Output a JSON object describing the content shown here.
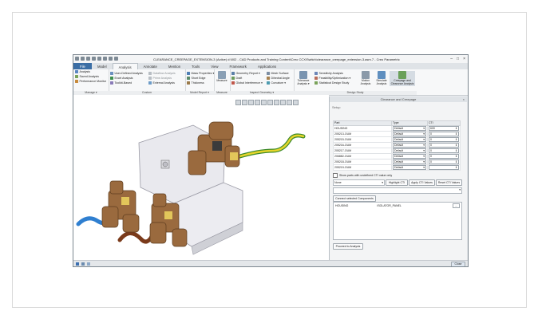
{
  "window": {
    "title": "CLEARANCE_CREEPAGE_EXTENSION-3 (Active) d:\\002 - CAD Products and Training Content\\Creo CCX\\Switch\\clearance_creepage_extension-3.asm.7 - Creo Parametric",
    "buttons": [
      "–",
      "□",
      "×"
    ]
  },
  "tabs": [
    "File",
    "Model",
    "Analysis",
    "Annotate",
    "Mention",
    "Tools",
    "View",
    "Framework",
    "Applications"
  ],
  "active_tab": "Analysis",
  "ribbon": {
    "manage": {
      "items": [
        "Analysis",
        "Saved Analysis",
        "Performance Monitor"
      ],
      "label": "Manage ▾"
    },
    "custom": {
      "col1": [
        "User-Defined Analysis",
        "Excel Analysis",
        "Toolkit-Based"
      ],
      "col2": [
        "Dataflow Analysis",
        "Prime Analysis",
        "External Analysis"
      ],
      "label": "Custom"
    },
    "model_report": {
      "items": [
        "Mass Properties ▾",
        "Short Edge",
        "Thickness"
      ],
      "label": "Model Report ▾"
    },
    "measure": {
      "button": "Measure",
      "label": "Measure"
    },
    "inspect": {
      "col1": [
        "Geometry Report ▾",
        "Draft",
        "Global Interference ▾"
      ],
      "col2": [
        "Mesh Surface",
        "Dihedral Angle",
        "Curvature ▾"
      ],
      "label": "Inspect Geometry ▾"
    },
    "design_study": {
      "tolerance": "Tolerance Analysis ▾",
      "col": [
        "Sensitivity Analysis",
        "Feasibility/Optimization ▾",
        "Statistical Design Study"
      ],
      "motion": "Motion Analysis",
      "simulate": "Simulate Analysis",
      "creepage": "Creepage and Clearance Analysis",
      "label": "Design Study"
    }
  },
  "panel": {
    "title": "Clearance and Creepage",
    "subtitle": "Setup",
    "columns": [
      "Part",
      "Type",
      "CTI"
    ],
    "rows": [
      {
        "part": "HOUSING",
        "type": "Default",
        "cti": "600"
      },
      {
        "part": "205213-OUM",
        "type": "Default",
        "cti": "0"
      },
      {
        "part": "205215-OUM",
        "type": "Default",
        "cti": "0"
      },
      {
        "part": "205216-OUM",
        "type": "Default",
        "cti": "0"
      },
      {
        "part": "205217-OUM",
        "type": "Default",
        "cti": "0"
      },
      {
        "part": "206882-OUM",
        "type": "Default",
        "cti": "0"
      },
      {
        "part": "205218-OUM",
        "type": "Default",
        "cti": "0"
      },
      {
        "part": "205219-OUM",
        "type": "Default",
        "cti": ""
      }
    ],
    "checkbox": "Show parts with undefined CTI value only",
    "select_value": "None",
    "buttons": [
      "Highlight CTI",
      "Apply CTI Values",
      "Reset CTI Values"
    ],
    "connect_btn": "Connect selected Components",
    "connection": {
      "from": "HOUSING",
      "to": "ISOLATOR_PANEL",
      "more": "..."
    },
    "proceed": "Proceed to Analysis",
    "close": "Close"
  }
}
